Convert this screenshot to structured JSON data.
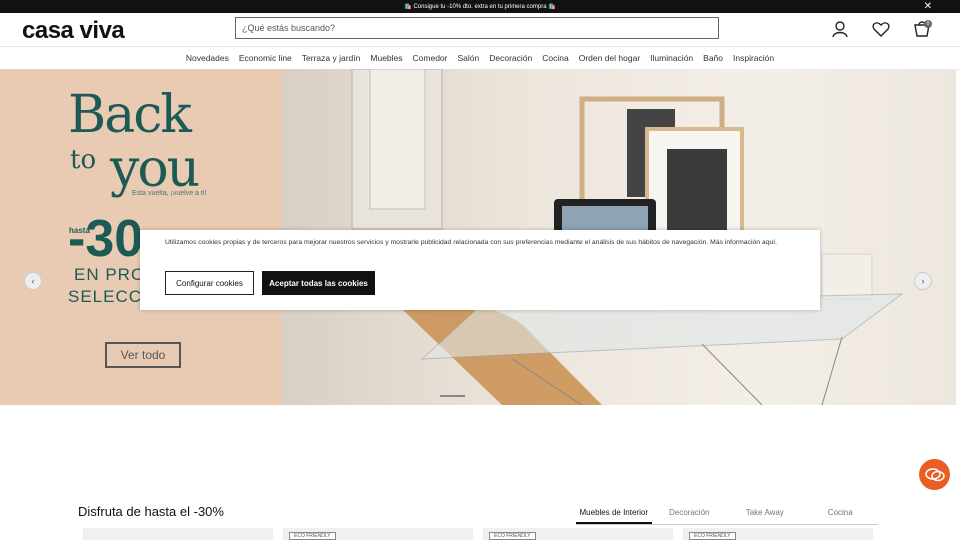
{
  "promo": {
    "text": "🛍️ Consigue tu -10% dto. extra en tu primera compra 🛍️",
    "close": "✕"
  },
  "header": {
    "logo": "casa viva",
    "search_placeholder": "¿Qué estás buscando?",
    "cart_count": "0"
  },
  "nav": [
    "Novedades",
    "Economic line",
    "Terraza y jardín",
    "Muebles",
    "Comedor",
    "Salón",
    "Decoración",
    "Cocina",
    "Orden del hogar",
    "Iluminación",
    "Baño",
    "Inspiración"
  ],
  "hero": {
    "back": "Back",
    "to": "to",
    "you": "you",
    "tagline": "Esta vuelta, ¡vuelve a ti!",
    "hasta": "hasta",
    "percent": "-30",
    "line1": "EN PRO",
    "line2": "SELECCI",
    "cta": "Ver todo",
    "prev": "‹",
    "next": "›"
  },
  "cookies": {
    "text": "Utilizamos cookies propias y de terceros para mejorar nuestros servicios y mostrarle publicidad relacionada con sus preferencias mediante el análisis de sus hábitos de navegación. Más información aquí.",
    "configure": "Configurar cookies",
    "accept": "Aceptar todas las cookies"
  },
  "section": {
    "title": "Disfruta de hasta el -30%",
    "tabs": [
      "Muebles de Interior",
      "Decoración",
      "Take Away",
      "Cocina"
    ],
    "badge": "ECO FRIENDLY"
  },
  "colors": {
    "brand_teal": "#1c5a55",
    "hero_left_bg": "#e9cbb3",
    "chat": "#e95e26"
  }
}
